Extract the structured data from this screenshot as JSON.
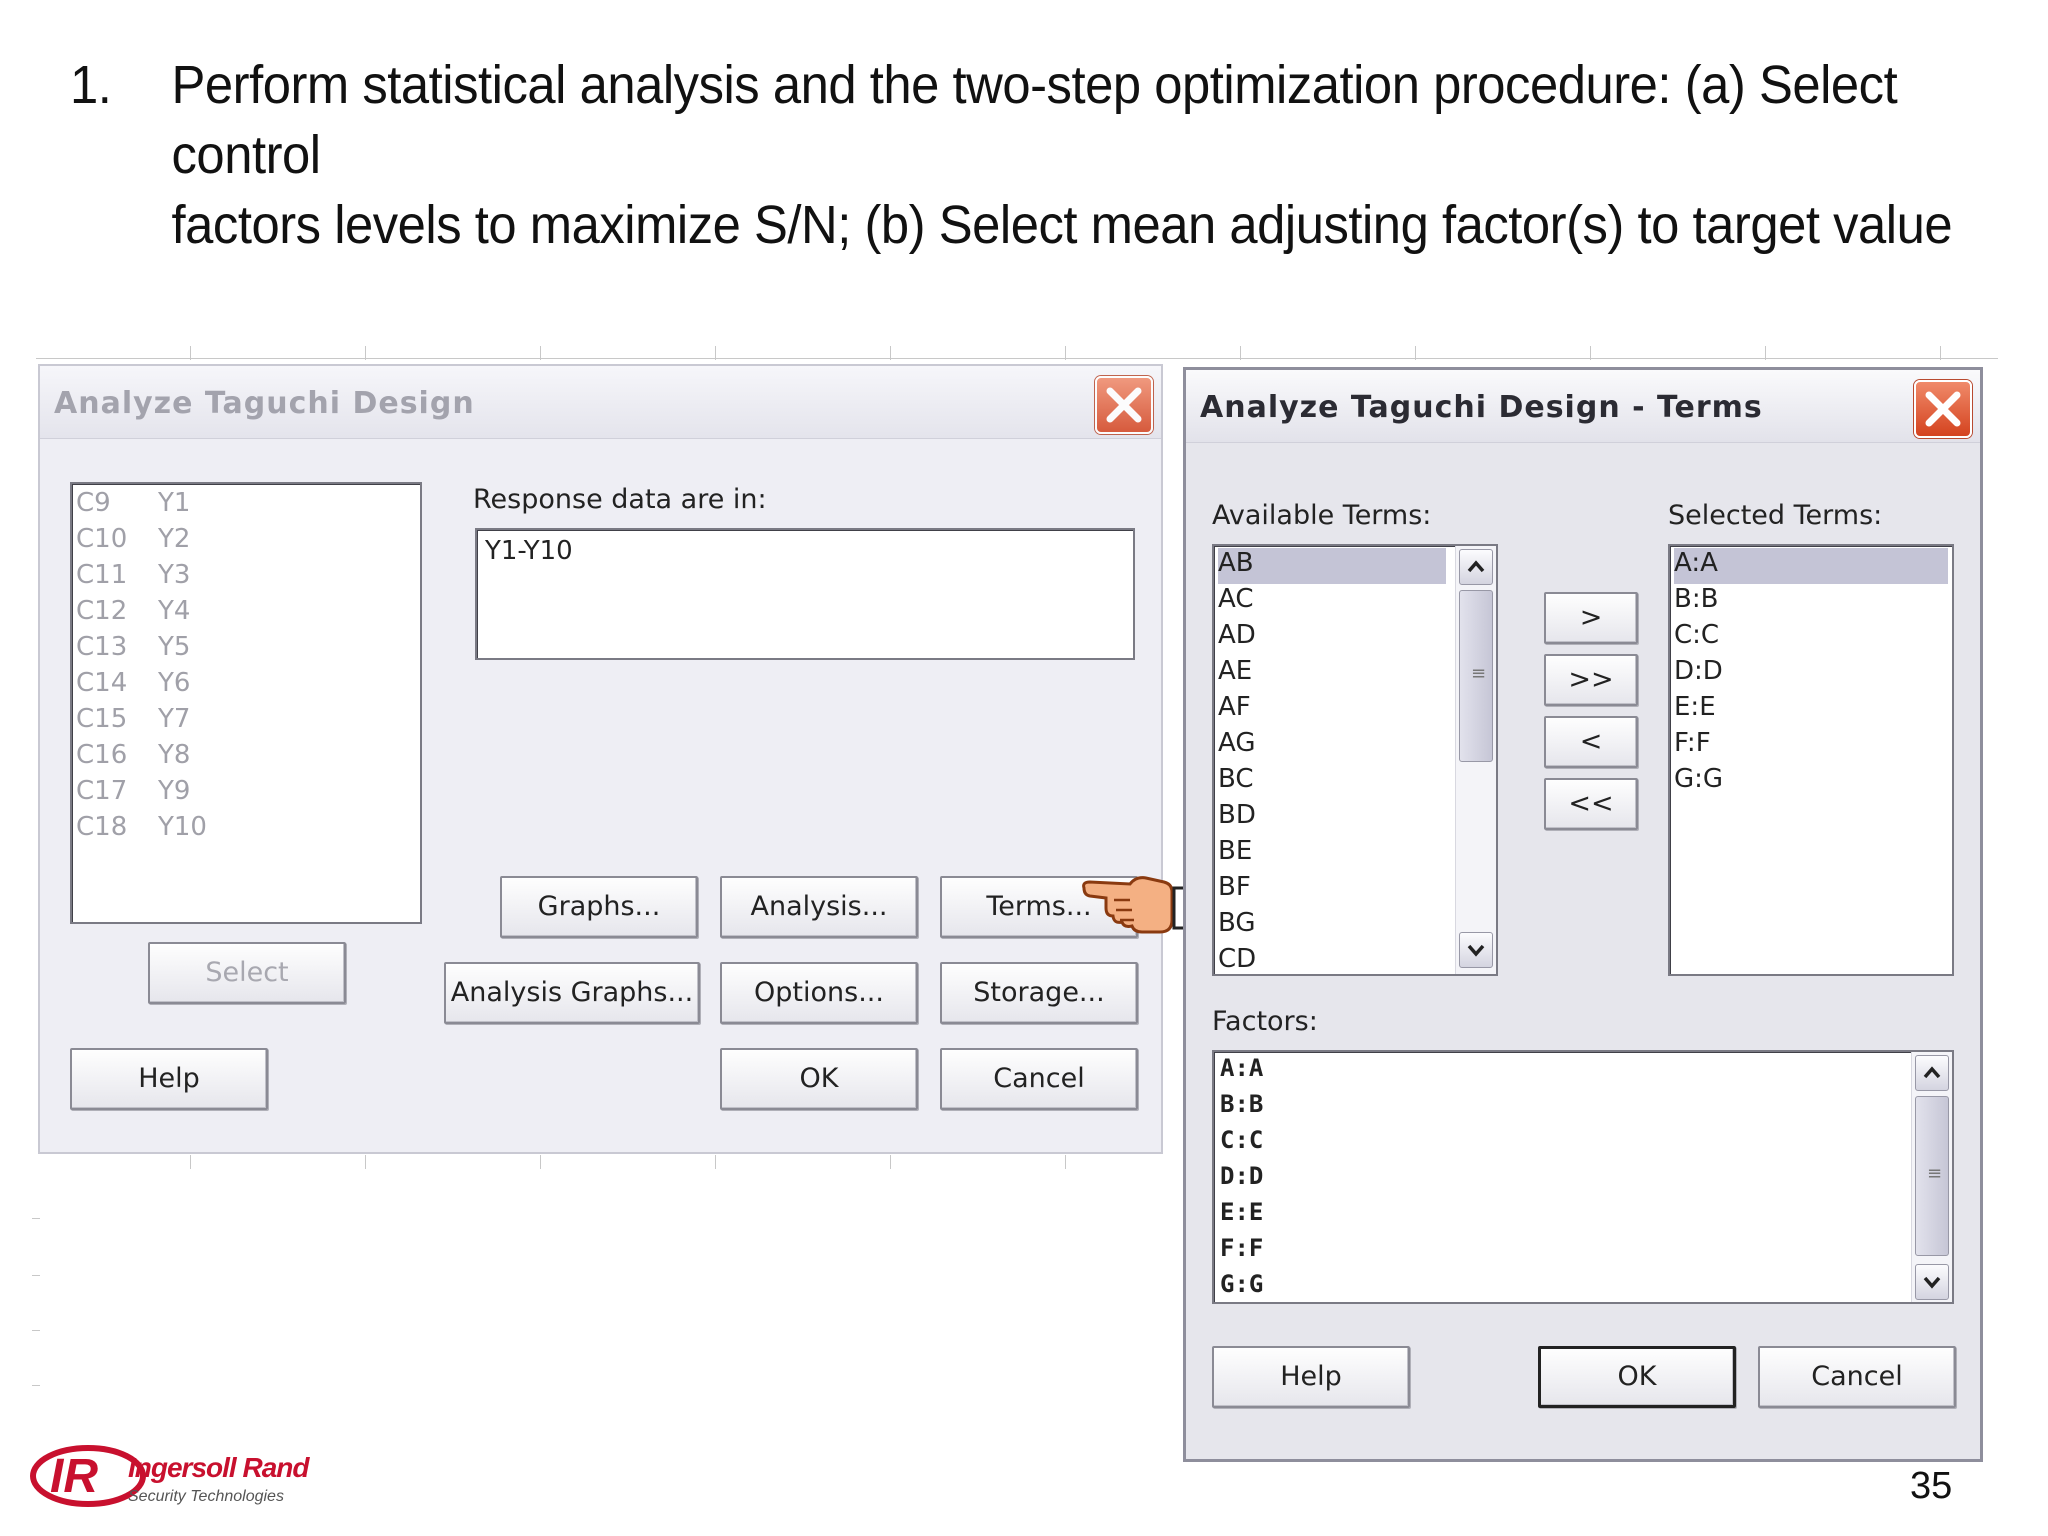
{
  "slide": {
    "number_label": "1.",
    "heading_line1": "Perform statistical analysis and the two-step optimization procedure: (a) Select control",
    "heading_line2": "factors levels to maximize S/N; (b) Select mean adjusting factor(s) to target value",
    "page_number": "35"
  },
  "logo": {
    "brand": "Ingersoll Rand",
    "tagline": "Security Technologies",
    "monogram": "IR",
    "brand_color": "#c8102e"
  },
  "analyze_dialog": {
    "title": "Analyze Taguchi Design",
    "columns": [
      {
        "name": "C9",
        "value": "Y1"
      },
      {
        "name": "C10",
        "value": "Y2"
      },
      {
        "name": "C11",
        "value": "Y3"
      },
      {
        "name": "C12",
        "value": "Y4"
      },
      {
        "name": "C13",
        "value": "Y5"
      },
      {
        "name": "C14",
        "value": "Y6"
      },
      {
        "name": "C15",
        "value": "Y7"
      },
      {
        "name": "C16",
        "value": "Y8"
      },
      {
        "name": "C17",
        "value": "Y9"
      },
      {
        "name": "C18",
        "value": "Y10"
      }
    ],
    "response_label": "Response data are in:",
    "response_value": "Y1-Y10",
    "buttons": {
      "graphs": "Graphs...",
      "analysis": "Analysis...",
      "terms": "Terms...",
      "select": "Select",
      "analysis_graphs": "Analysis Graphs...",
      "options": "Options...",
      "storage": "Storage...",
      "help": "Help",
      "ok": "OK",
      "cancel": "Cancel"
    }
  },
  "terms_dialog": {
    "title": "Analyze Taguchi Design - Terms",
    "available_label": "Available Terms:",
    "selected_label": "Selected Terms:",
    "available_terms": [
      "AB",
      "AC",
      "AD",
      "AE",
      "AF",
      "AG",
      "BC",
      "BD",
      "BE",
      "BF",
      "BG",
      "CD"
    ],
    "selected_terms": [
      "A:A",
      "B:B",
      "C:C",
      "D:D",
      "E:E",
      "F:F",
      "G:G"
    ],
    "factors_label": "Factors:",
    "factors": [
      "A:A",
      "B:B",
      "C:C",
      "D:D",
      "E:E",
      "F:F",
      "G:G"
    ],
    "move_buttons": {
      "add_one": ">",
      "add_all": ">>",
      "remove_one": "<",
      "remove_all": "<<"
    },
    "buttons": {
      "help": "Help",
      "ok": "OK",
      "cancel": "Cancel"
    }
  },
  "colors": {
    "close_button": "#d4431f",
    "selection_highlight": "#c4c4d6",
    "dialog_background": "#eeeef4"
  }
}
